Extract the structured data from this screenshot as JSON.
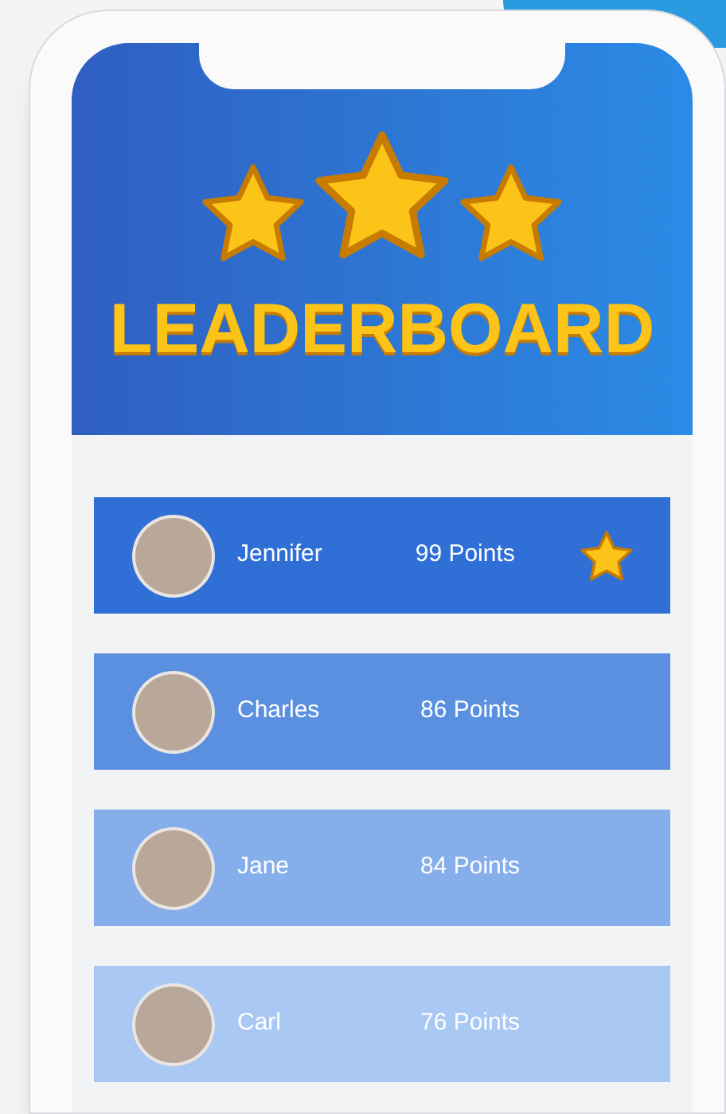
{
  "header": {
    "title": "LEADERBOARD",
    "stars": 3
  },
  "rows": [
    {
      "name": "Jennifer",
      "points": "99 Points",
      "starred": true,
      "color": "#2f6fd6"
    },
    {
      "name": "Charles",
      "points": "86 Points",
      "starred": false,
      "color": "#5b8fe0"
    },
    {
      "name": "Jane",
      "points": "84 Points",
      "starred": false,
      "color": "#86aeea"
    },
    {
      "name": "Carl",
      "points": "76 Points",
      "starred": false,
      "color": "#a9c8f3"
    }
  ]
}
